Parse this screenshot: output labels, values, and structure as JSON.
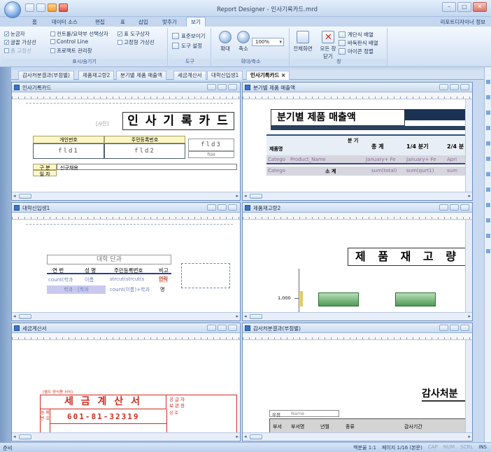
{
  "window": {
    "title": "Report Designer - 인사기록카드.mrd",
    "controls": [
      "–",
      "□",
      "✕"
    ]
  },
  "ribbon_tabs": {
    "items": [
      "홈",
      "데이터 소스",
      "편집",
      "표",
      "삽입",
      "맞추기",
      "보기"
    ],
    "active": "보기",
    "right_label": "리포트디자이너 정보"
  },
  "ribbon": {
    "show_hide": {
      "label": "표시/숨기기",
      "items": [
        {
          "label": "눈금자",
          "checked": true,
          "enabled": true
        },
        {
          "label": "컨트롤/요약부 선택상자",
          "checked": false,
          "enabled": true
        },
        {
          "label": "표 도구상자",
          "checked": true,
          "enabled": true
        },
        {
          "label": "글꼴 가상선",
          "checked": true,
          "enabled": true
        },
        {
          "label": "Control Line",
          "checked": false,
          "enabled": true
        },
        {
          "label": "고정형 가상선",
          "checked": false,
          "enabled": true
        },
        {
          "label": "폼 고정선",
          "checked": false,
          "enabled": false
        },
        {
          "label": "프로젝트 관리창",
          "checked": false,
          "enabled": true
        }
      ]
    },
    "options": {
      "label": "도구",
      "items": [
        "표준보이기",
        "도구 설정"
      ]
    },
    "zoom": {
      "label": "확대/축소",
      "zoom_in": "확대",
      "zoom_out": "축소",
      "value": "100%"
    },
    "window_group": {
      "label": "창",
      "fullscreen": "전체화면",
      "close_all": "모든 창 닫기",
      "cascade": "계단식 배열",
      "tile": "바둑판식 배열",
      "arrange_icons": "아이콘 정렬"
    }
  },
  "doc_tabs": {
    "items": [
      "감사처분결과(부점별)",
      "제품재고량2",
      "분기별 제품 매출액",
      "세금계산서",
      "대학신입생1",
      "인사기록카드"
    ],
    "active": "인사기록카드",
    "close": "×"
  },
  "panels": [
    {
      "title": "인사기록카드",
      "report_title": "인 사 기 록 카 드",
      "photo_label": "[사진]",
      "headers": [
        "개인번호",
        "주민등록번호"
      ],
      "fields": [
        "fld1",
        "fld2",
        "fld3",
        "fld4"
      ],
      "row_labels": [
        "구 분",
        "일 자",
        "신규채용"
      ]
    },
    {
      "title": "분기별 제품 매출액",
      "report_title": "분기별 제품 매출액",
      "headers": [
        "분 기",
        "제품명",
        "총 계",
        "1/4 분기",
        "2/4 분"
      ],
      "row1": [
        "Catego",
        "Product_Name",
        "January+ Fe",
        "January+ Fe",
        "Apri"
      ],
      "row2": [
        "Catego",
        "소 계",
        "sum(total)",
        "sum(qurt1)",
        "sum"
      ]
    },
    {
      "title": "대학신입생1",
      "report_title": "대학 단과",
      "headers": [
        "연 번",
        "성 명",
        "주민등록번호",
        "비고"
      ],
      "row1": [
        "count(학과",
        "이름",
        "strcut(strcut(s",
        "연락"
      ],
      "row2": [
        "학과 - [학과",
        "count(이름)+학과",
        "명"
      ]
    },
    {
      "title": "제품재고량2",
      "report_title": "제 품 재 고 량",
      "axis_label": "1,000"
    },
    {
      "title": "세금계산서",
      "small_header": "(별도 양식용 서식)",
      "report_title": "세 금 계 산 서",
      "side_labels": [
        "공 급 자",
        "보 관 용"
      ],
      "reg_no": "601-81-32319",
      "left_labels": [
        "등 록 번 호",
        "상 호"
      ]
    },
    {
      "title": "감사처분결과(부점별)",
      "report_title": "감사처분",
      "filter_label": "부점",
      "filter_value": "Name",
      "headers": [
        "부서",
        "부서명",
        "년월",
        "종류",
        "감사기간"
      ]
    }
  ],
  "statusbar": {
    "left": "준비",
    "zoom": "백분율 1:1",
    "page": "페이지 1/16 (본문)",
    "keys": [
      "CAP",
      "NUM",
      "SCRL",
      "INS"
    ]
  }
}
